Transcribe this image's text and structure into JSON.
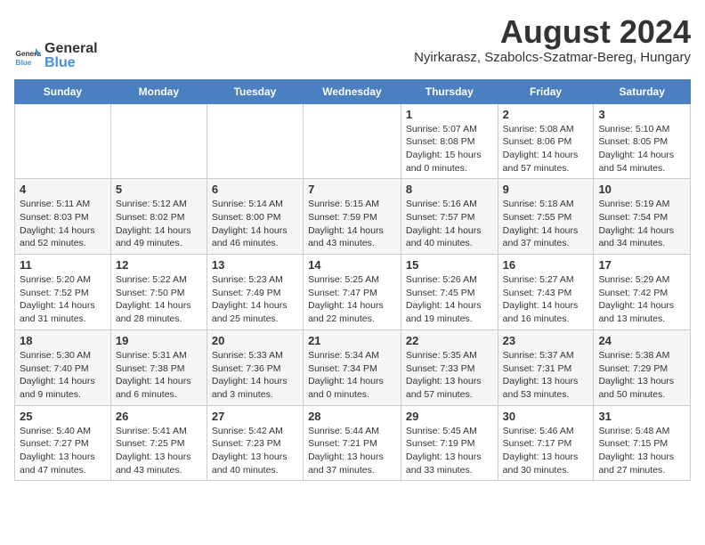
{
  "logo": {
    "general": "General",
    "blue": "Blue"
  },
  "title": "August 2024",
  "subtitle": "Nyirkarasz, Szabolcs-Szatmar-Bereg, Hungary",
  "days_of_week": [
    "Sunday",
    "Monday",
    "Tuesday",
    "Wednesday",
    "Thursday",
    "Friday",
    "Saturday"
  ],
  "weeks": [
    [
      {
        "day": "",
        "info": ""
      },
      {
        "day": "",
        "info": ""
      },
      {
        "day": "",
        "info": ""
      },
      {
        "day": "",
        "info": ""
      },
      {
        "day": "1",
        "info": "Sunrise: 5:07 AM\nSunset: 8:08 PM\nDaylight: 15 hours\nand 0 minutes."
      },
      {
        "day": "2",
        "info": "Sunrise: 5:08 AM\nSunset: 8:06 PM\nDaylight: 14 hours\nand 57 minutes."
      },
      {
        "day": "3",
        "info": "Sunrise: 5:10 AM\nSunset: 8:05 PM\nDaylight: 14 hours\nand 54 minutes."
      }
    ],
    [
      {
        "day": "4",
        "info": "Sunrise: 5:11 AM\nSunset: 8:03 PM\nDaylight: 14 hours\nand 52 minutes."
      },
      {
        "day": "5",
        "info": "Sunrise: 5:12 AM\nSunset: 8:02 PM\nDaylight: 14 hours\nand 49 minutes."
      },
      {
        "day": "6",
        "info": "Sunrise: 5:14 AM\nSunset: 8:00 PM\nDaylight: 14 hours\nand 46 minutes."
      },
      {
        "day": "7",
        "info": "Sunrise: 5:15 AM\nSunset: 7:59 PM\nDaylight: 14 hours\nand 43 minutes."
      },
      {
        "day": "8",
        "info": "Sunrise: 5:16 AM\nSunset: 7:57 PM\nDaylight: 14 hours\nand 40 minutes."
      },
      {
        "day": "9",
        "info": "Sunrise: 5:18 AM\nSunset: 7:55 PM\nDaylight: 14 hours\nand 37 minutes."
      },
      {
        "day": "10",
        "info": "Sunrise: 5:19 AM\nSunset: 7:54 PM\nDaylight: 14 hours\nand 34 minutes."
      }
    ],
    [
      {
        "day": "11",
        "info": "Sunrise: 5:20 AM\nSunset: 7:52 PM\nDaylight: 14 hours\nand 31 minutes."
      },
      {
        "day": "12",
        "info": "Sunrise: 5:22 AM\nSunset: 7:50 PM\nDaylight: 14 hours\nand 28 minutes."
      },
      {
        "day": "13",
        "info": "Sunrise: 5:23 AM\nSunset: 7:49 PM\nDaylight: 14 hours\nand 25 minutes."
      },
      {
        "day": "14",
        "info": "Sunrise: 5:25 AM\nSunset: 7:47 PM\nDaylight: 14 hours\nand 22 minutes."
      },
      {
        "day": "15",
        "info": "Sunrise: 5:26 AM\nSunset: 7:45 PM\nDaylight: 14 hours\nand 19 minutes."
      },
      {
        "day": "16",
        "info": "Sunrise: 5:27 AM\nSunset: 7:43 PM\nDaylight: 14 hours\nand 16 minutes."
      },
      {
        "day": "17",
        "info": "Sunrise: 5:29 AM\nSunset: 7:42 PM\nDaylight: 14 hours\nand 13 minutes."
      }
    ],
    [
      {
        "day": "18",
        "info": "Sunrise: 5:30 AM\nSunset: 7:40 PM\nDaylight: 14 hours\nand 9 minutes."
      },
      {
        "day": "19",
        "info": "Sunrise: 5:31 AM\nSunset: 7:38 PM\nDaylight: 14 hours\nand 6 minutes."
      },
      {
        "day": "20",
        "info": "Sunrise: 5:33 AM\nSunset: 7:36 PM\nDaylight: 14 hours\nand 3 minutes."
      },
      {
        "day": "21",
        "info": "Sunrise: 5:34 AM\nSunset: 7:34 PM\nDaylight: 14 hours\nand 0 minutes."
      },
      {
        "day": "22",
        "info": "Sunrise: 5:35 AM\nSunset: 7:33 PM\nDaylight: 13 hours\nand 57 minutes."
      },
      {
        "day": "23",
        "info": "Sunrise: 5:37 AM\nSunset: 7:31 PM\nDaylight: 13 hours\nand 53 minutes."
      },
      {
        "day": "24",
        "info": "Sunrise: 5:38 AM\nSunset: 7:29 PM\nDaylight: 13 hours\nand 50 minutes."
      }
    ],
    [
      {
        "day": "25",
        "info": "Sunrise: 5:40 AM\nSunset: 7:27 PM\nDaylight: 13 hours\nand 47 minutes."
      },
      {
        "day": "26",
        "info": "Sunrise: 5:41 AM\nSunset: 7:25 PM\nDaylight: 13 hours\nand 43 minutes."
      },
      {
        "day": "27",
        "info": "Sunrise: 5:42 AM\nSunset: 7:23 PM\nDaylight: 13 hours\nand 40 minutes."
      },
      {
        "day": "28",
        "info": "Sunrise: 5:44 AM\nSunset: 7:21 PM\nDaylight: 13 hours\nand 37 minutes."
      },
      {
        "day": "29",
        "info": "Sunrise: 5:45 AM\nSunset: 7:19 PM\nDaylight: 13 hours\nand 33 minutes."
      },
      {
        "day": "30",
        "info": "Sunrise: 5:46 AM\nSunset: 7:17 PM\nDaylight: 13 hours\nand 30 minutes."
      },
      {
        "day": "31",
        "info": "Sunrise: 5:48 AM\nSunset: 7:15 PM\nDaylight: 13 hours\nand 27 minutes."
      }
    ]
  ]
}
